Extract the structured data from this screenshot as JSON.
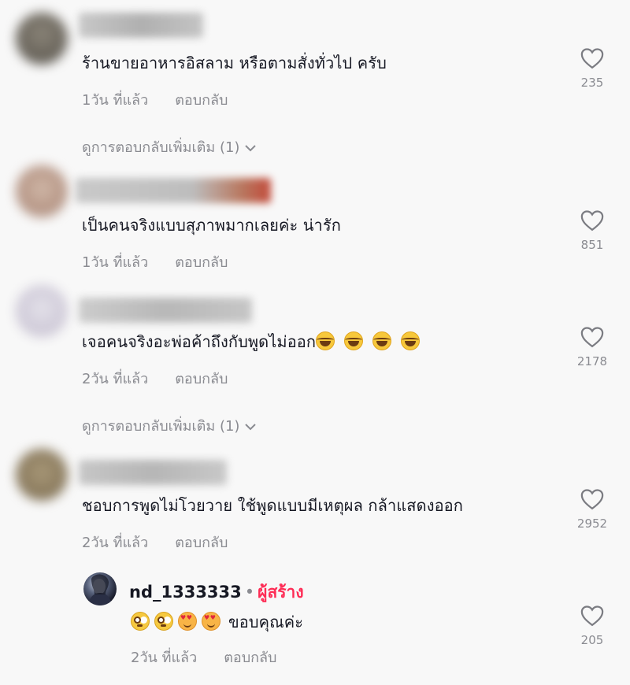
{
  "comments": [
    {
      "text": "ร้านขายอาหารอิสลาม หรือตามสั่งทั่วไป ครับ",
      "time": "1วัน ที่แล้ว",
      "reply_label": "ตอบกลับ",
      "likes": "235",
      "more_replies": "ดูการตอบกลับเพิ่มเติม (1)"
    },
    {
      "text": "เป็นคนจริงแบบสุภาพมากเลยค่ะ น่ารัก",
      "time": "1วัน ที่แล้ว",
      "reply_label": "ตอบกลับ",
      "likes": "851"
    },
    {
      "text": "เจอคนจริงอะพ่อค้าถึงกับพูดไม่ออก",
      "time": "2วัน ที่แล้ว",
      "reply_label": "ตอบกลับ",
      "likes": "2178",
      "more_replies": "ดูการตอบกลับเพิ่มเติม (1)"
    },
    {
      "text": "ชอบการพูดไม่โวยวาย ใช้พูดแบบมีเหตุผล กล้าแสดงออก",
      "time": "2วัน ที่แล้ว",
      "reply_label": "ตอบกลับ",
      "likes": "2952"
    }
  ],
  "reply": {
    "username": "nd_1333333",
    "separator": "•",
    "creator_label": "ผู้สร้าง",
    "text": "ขอบคุณค่ะ",
    "time": "2วัน ที่แล้ว",
    "reply_label": "ตอบกลับ",
    "likes": "205"
  },
  "colors": {
    "creator": "#fe2c55",
    "secondary_text": "#8a8b91",
    "background": "#f8f8f8"
  },
  "icons": {
    "like": "heart-outline-icon",
    "expand": "chevron-down-icon"
  }
}
